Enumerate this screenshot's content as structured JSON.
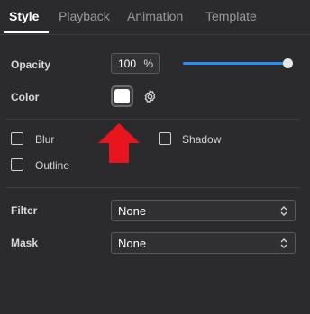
{
  "tabs": [
    {
      "label": "Style",
      "active": true
    },
    {
      "label": "Playback",
      "active": false
    },
    {
      "label": "Animation",
      "active": false
    },
    {
      "label": "Template",
      "active": false
    }
  ],
  "opacity": {
    "label": "Opacity",
    "value": "100",
    "unit": "%",
    "slider_fraction": 1.0
  },
  "color": {
    "label": "Color",
    "swatch": "#ffffff",
    "icon": "gear-icon"
  },
  "effects": [
    {
      "label": "Blur",
      "checked": false
    },
    {
      "label": "Shadow",
      "checked": false
    },
    {
      "label": "Outline",
      "checked": false
    }
  ],
  "filter": {
    "label": "Filter",
    "value": "None"
  },
  "mask": {
    "label": "Mask",
    "value": "None"
  },
  "colors": {
    "background": "#2b2b2d",
    "accent": "#2d8cf0",
    "arrow": "#e8141e"
  }
}
